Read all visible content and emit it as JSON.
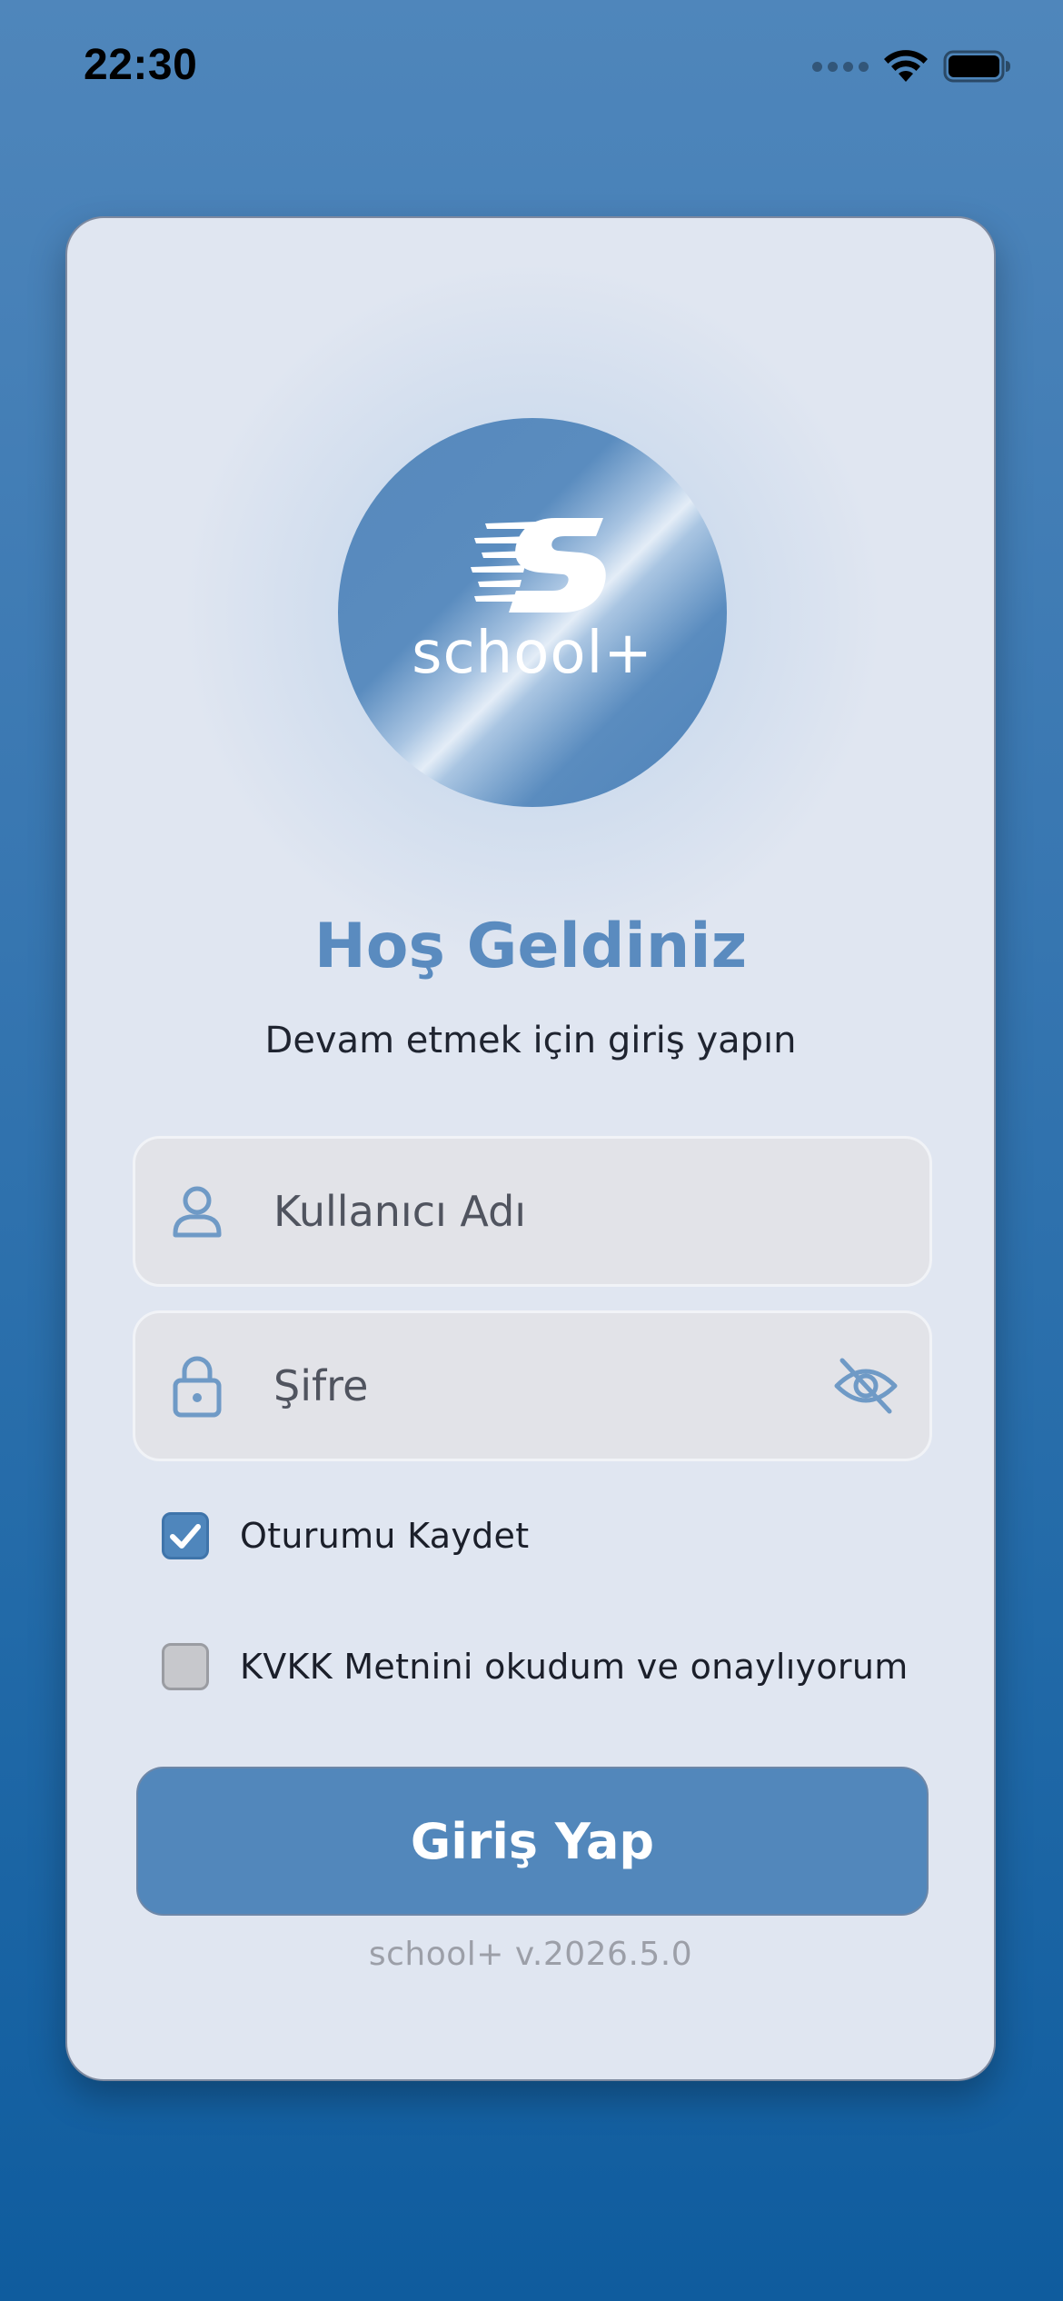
{
  "status_bar": {
    "time": "22:30",
    "signal_icon": "cellular-signal-icon",
    "wifi_icon": "wifi-icon",
    "battery_icon": "battery-icon"
  },
  "logo": {
    "text": "school+",
    "icon": "school-plus-logo"
  },
  "header": {
    "title": "Hoş Geldiniz",
    "subtitle": "Devam etmek için giriş yapın"
  },
  "form": {
    "username": {
      "placeholder": "Kullanıcı Adı",
      "value": "",
      "icon": "user-icon"
    },
    "password": {
      "placeholder": "Şifre",
      "value": "",
      "icon": "lock-icon",
      "toggle_icon": "eye-off-icon"
    },
    "remember_me": {
      "label": "Oturumu Kaydet",
      "checked": true
    },
    "kvkk": {
      "label": "KVKK Metnini okudum ve onaylıyorum",
      "checked": false
    },
    "submit_label": "Giriş Yap"
  },
  "footer": {
    "version": "school+ v.2026.5.0"
  },
  "colors": {
    "accent": "#5287bb",
    "title": "#5a8bbf",
    "card_background": "#e0e6f1",
    "background_top": "#4f86bb",
    "background_bottom": "#0f5c9e"
  }
}
